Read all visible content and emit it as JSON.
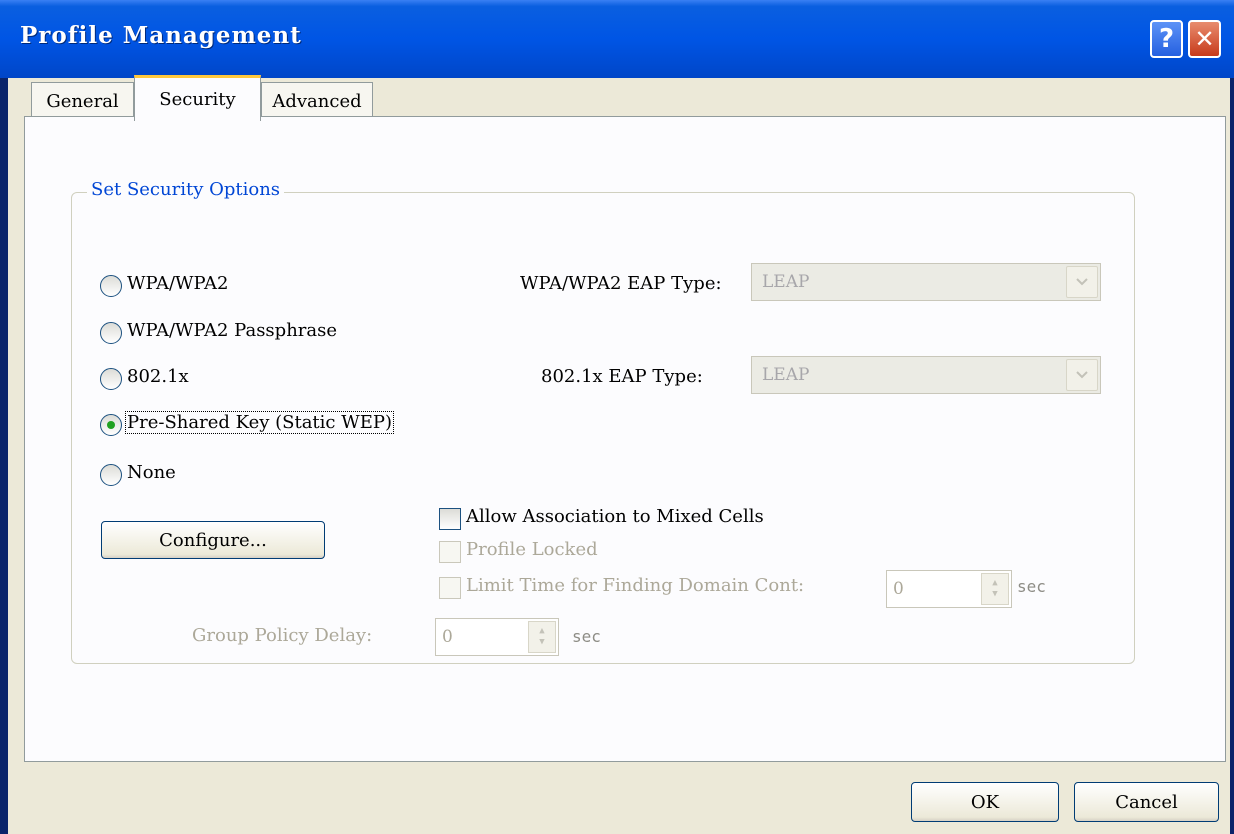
{
  "window": {
    "title": "Profile Management",
    "help_label": "?",
    "close_label": "✕"
  },
  "tabs": [
    {
      "label": "General",
      "selected": false
    },
    {
      "label": "Security",
      "selected": true
    },
    {
      "label": "Advanced",
      "selected": false
    }
  ],
  "group": {
    "label": "Set Security Options"
  },
  "options": [
    {
      "label": "WPA/WPA2",
      "checked": false
    },
    {
      "label": "WPA/WPA2 Passphrase",
      "checked": false
    },
    {
      "label": "802.1x",
      "checked": false
    },
    {
      "label": "Pre-Shared Key (Static WEP)",
      "checked": true
    },
    {
      "label": "None",
      "checked": false
    }
  ],
  "eap": {
    "wpa_label": "WPA/WPA2 EAP Type:",
    "wpa_value": "LEAP",
    "dot1x_label": "802.1x EAP Type:",
    "dot1x_value": "LEAP"
  },
  "configure_label": "Configure...",
  "checkboxes": {
    "mixed_cells": {
      "label": "Allow Association to Mixed Cells",
      "checked": false,
      "enabled": true
    },
    "profile_locked": {
      "label": "Profile Locked",
      "checked": false,
      "enabled": false
    },
    "limit_time": {
      "label": "Limit Time for Finding Domain Cont:",
      "checked": false,
      "enabled": false,
      "value": "0",
      "unit": "sec"
    }
  },
  "group_policy": {
    "label": "Group Policy Delay:",
    "value": "0",
    "unit": "sec"
  },
  "footer": {
    "ok_label": "OK",
    "cancel_label": "Cancel"
  },
  "icons": {
    "combo_arrow": "chevron-down-icon",
    "spin_up": "spin-up-icon",
    "spin_down": "spin-down-icon"
  }
}
